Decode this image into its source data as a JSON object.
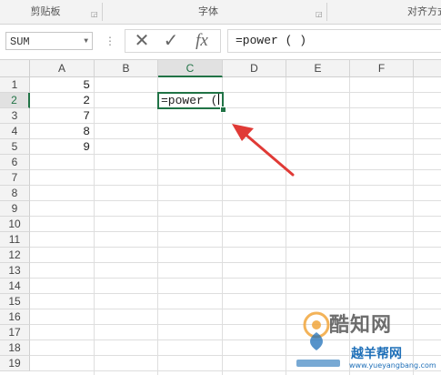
{
  "ribbon": {
    "groups": [
      "剪贴板",
      "字体",
      "对齐方式"
    ]
  },
  "formula_bar": {
    "name_box": "SUM",
    "separator": "⋮",
    "cancel_icon": "✕",
    "enter_icon": "✓",
    "fx_label": "fx",
    "formula": "=power ( )"
  },
  "columns": [
    "A",
    "B",
    "C",
    "D",
    "E",
    "F"
  ],
  "rows": [
    "1",
    "2",
    "3",
    "4",
    "5",
    "6",
    "7",
    "8",
    "9",
    "10",
    "11",
    "12",
    "13",
    "14",
    "15",
    "16",
    "17",
    "18",
    "19"
  ],
  "cells": {
    "A1": "5",
    "A2": "2",
    "A3": "7",
    "A4": "8",
    "A5": "9",
    "C2_before_caret": "=power (",
    "C2_after_caret": ""
  },
  "active_cell": "C2",
  "watermark": {
    "brand": "酷知网",
    "brand2": "越羊帮网",
    "url": "www.yueyangbang.com"
  },
  "colors": {
    "accent": "#217346",
    "arrow": "#e03a36"
  }
}
